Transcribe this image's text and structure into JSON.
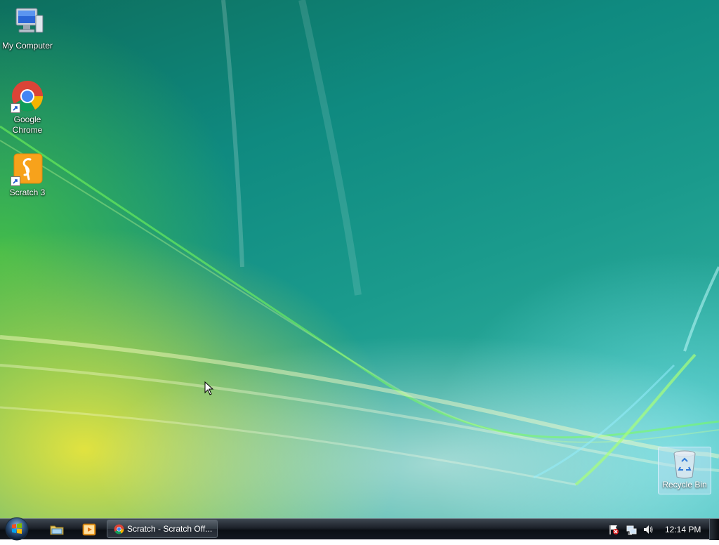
{
  "desktop": {
    "icons": [
      {
        "label": "My Computer",
        "icon": "computer-icon"
      },
      {
        "label": "Google Chrome",
        "icon": "chrome-icon",
        "shortcut": true
      },
      {
        "label": "Scratch 3",
        "icon": "scratch-icon",
        "shortcut": true
      }
    ],
    "recycle_bin": {
      "label": "Recycle Bin",
      "icon": "recycle-bin-icon"
    }
  },
  "taskbar": {
    "start": {
      "icon": "windows-logo-icon"
    },
    "quick_launch": [
      {
        "name": "explorer",
        "icon": "folder-icon"
      },
      {
        "name": "media",
        "icon": "media-player-icon"
      }
    ],
    "tasks": [
      {
        "label": "Scratch - Scratch Off...",
        "icon": "chrome-icon"
      }
    ],
    "tray": {
      "icons": [
        "action-center-flag-icon",
        "network-icon",
        "volume-icon"
      ],
      "clock": "12:14 PM"
    }
  },
  "colors": {
    "taskbar": "#131820",
    "desktop_teal": "#0f8a80",
    "accent_green": "#50c83c",
    "accent_yellow": "#ebe63c"
  }
}
